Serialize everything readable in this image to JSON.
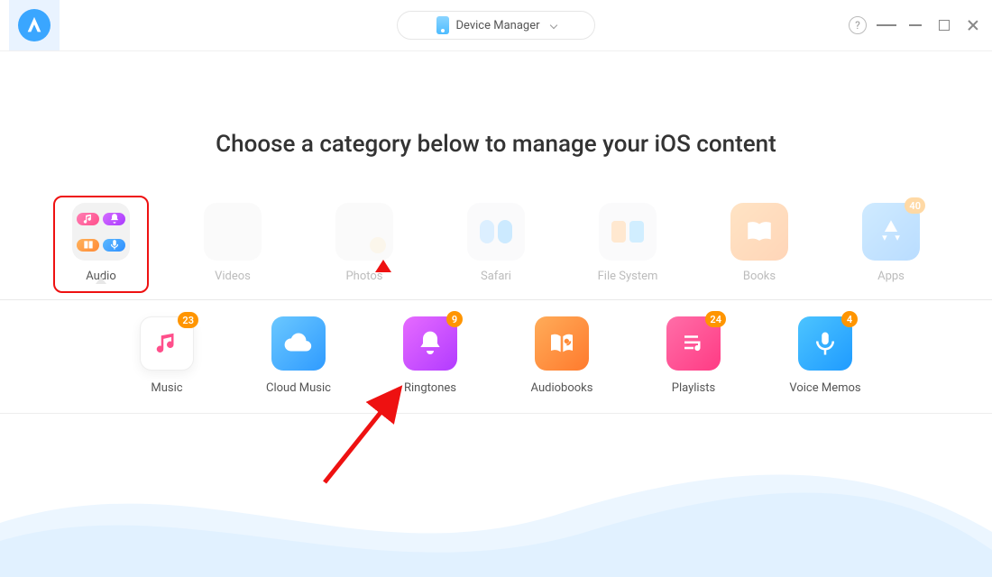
{
  "titlebar": {
    "dropdown_label": "Device Manager"
  },
  "page_title": "Choose a category below to manage your iOS content",
  "categories": [
    {
      "label": "Audio",
      "faded": false
    },
    {
      "label": "Videos",
      "faded": true
    },
    {
      "label": "Photos",
      "faded": true
    },
    {
      "label": "Safari",
      "faded": true
    },
    {
      "label": "File System",
      "faded": true
    },
    {
      "label": "Books",
      "faded": true
    },
    {
      "label": "Apps",
      "faded": true,
      "badge": 40
    }
  ],
  "selected_category_index": 0,
  "sub_items": [
    {
      "label": "Music",
      "badge": 23
    },
    {
      "label": "Cloud Music"
    },
    {
      "label": "Ringtones",
      "badge": 9
    },
    {
      "label": "Audiobooks"
    },
    {
      "label": "Playlists",
      "badge": 24
    },
    {
      "label": "Voice Memos",
      "badge": 4
    }
  ],
  "annotation": {
    "pointer_index": 2
  }
}
